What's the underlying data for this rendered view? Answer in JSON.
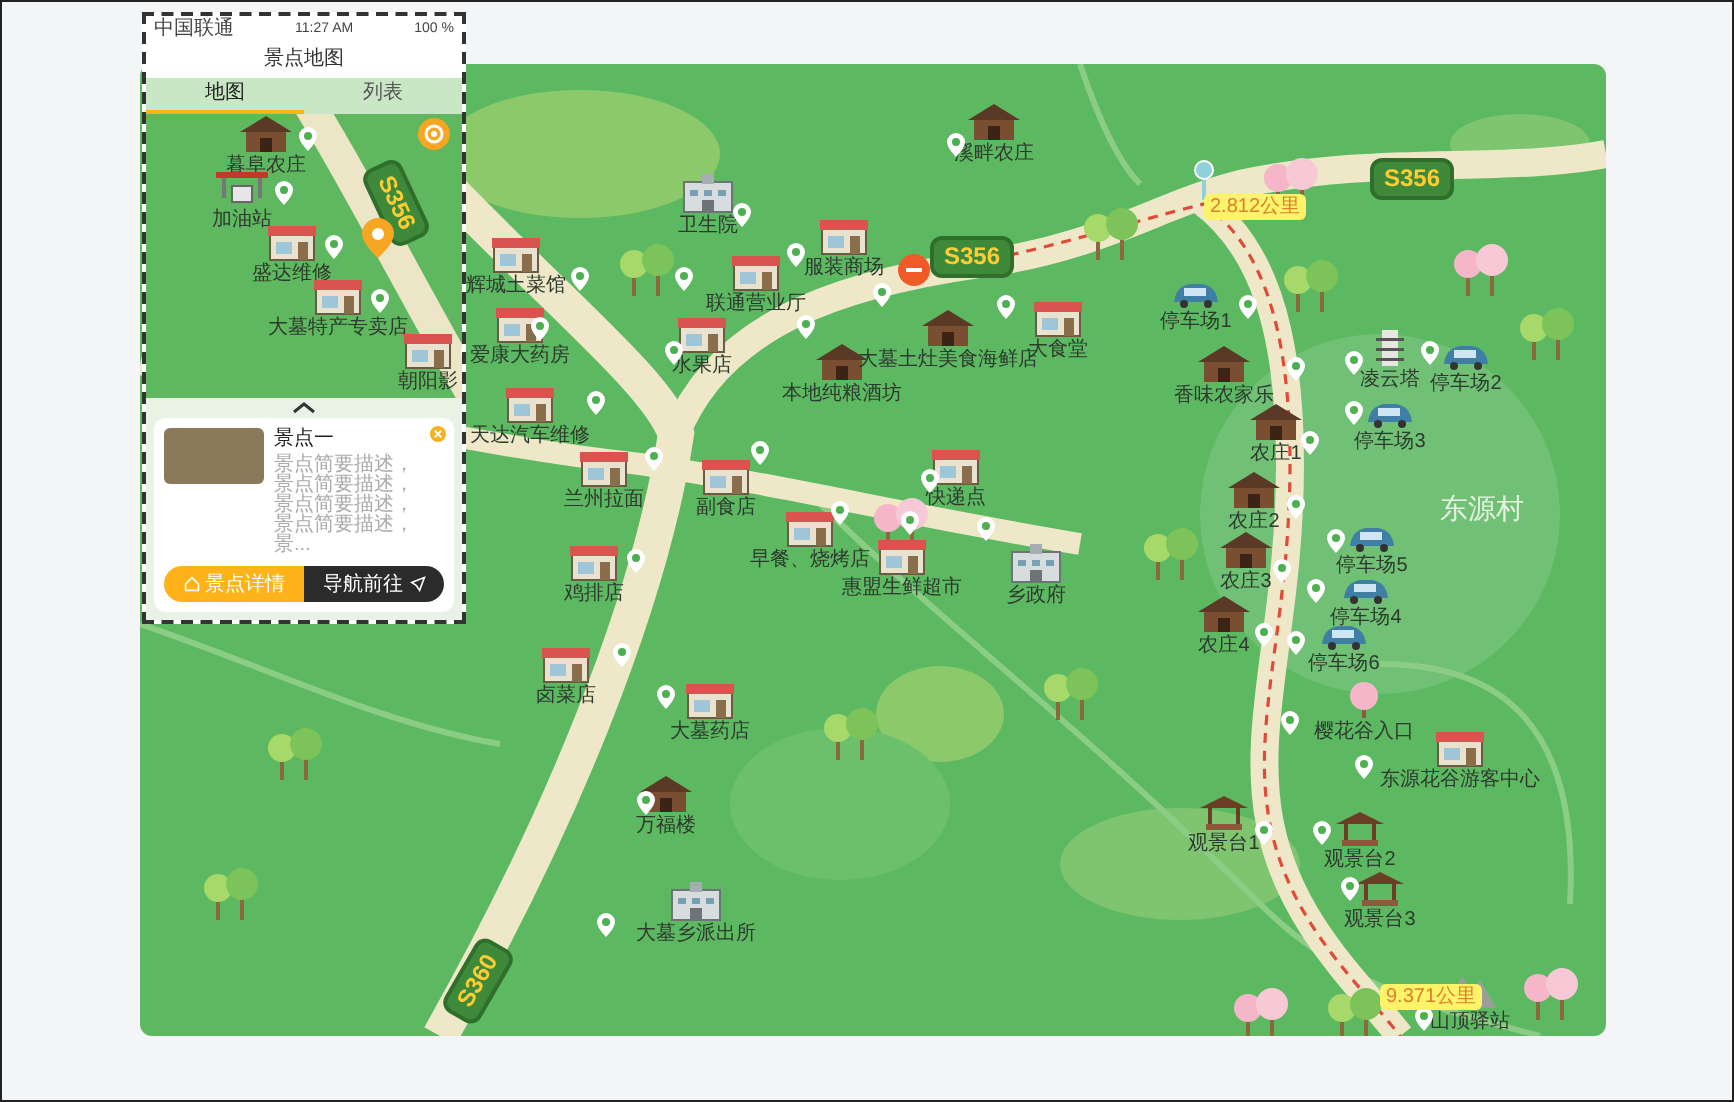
{
  "phone": {
    "status_bar": {
      "carrier": "中国联通",
      "time": "11:27 AM",
      "battery": "100 %"
    },
    "title": "景点地图",
    "tabs": [
      {
        "label": "地图",
        "selected": true
      },
      {
        "label": "列表",
        "selected": false
      }
    ],
    "places": [
      {
        "name": "暮阜农庄",
        "kind": "farm"
      },
      {
        "name": "加油站",
        "kind": "station"
      },
      {
        "name": "盛达维修",
        "kind": "shop"
      },
      {
        "name": "大墓特产专卖店",
        "kind": "shop"
      },
      {
        "name": "朝阳影",
        "kind": "shop"
      }
    ],
    "road_sign": "S356",
    "card": {
      "title": "景点一",
      "description": "景点简要描述，景点简要描述，景点简要描述，景点简要描述，景...",
      "buttons": [
        {
          "label": "景点详情",
          "kind": "primary"
        },
        {
          "label": "导航前往",
          "kind": "dark"
        }
      ]
    }
  },
  "map": {
    "village": "东源村",
    "road_signs": [
      "S356",
      "S356",
      "S360"
    ],
    "distances": [
      "2.812公里",
      "9.371公里"
    ],
    "places": [
      {
        "name": "溪畔农庄",
        "kind": "farm"
      },
      {
        "name": "卫生院",
        "kind": "office"
      },
      {
        "name": "服装商场",
        "kind": "shop"
      },
      {
        "name": "联通营业厅",
        "kind": "shop"
      },
      {
        "name": "辉城土菜馆",
        "kind": "shop"
      },
      {
        "name": "爱康大药房",
        "kind": "shop"
      },
      {
        "name": "水果店",
        "kind": "shop"
      },
      {
        "name": "本地纯粮酒坊",
        "kind": "farm"
      },
      {
        "name": "大墓土灶美食海鲜店",
        "kind": "farm"
      },
      {
        "name": "大食堂",
        "kind": "shop"
      },
      {
        "name": "天达汽车维修",
        "kind": "shop"
      },
      {
        "name": "兰州拉面",
        "kind": "shop"
      },
      {
        "name": "副食店",
        "kind": "shop"
      },
      {
        "name": "快递点",
        "kind": "shop"
      },
      {
        "name": "早餐、烧烤店",
        "kind": "shop"
      },
      {
        "name": "鸡排店",
        "kind": "shop"
      },
      {
        "name": "惠盟生鲜超市",
        "kind": "shop"
      },
      {
        "name": "乡政府",
        "kind": "office"
      },
      {
        "name": "卤菜店",
        "kind": "shop"
      },
      {
        "name": "大墓药店",
        "kind": "shop"
      },
      {
        "name": "万福楼",
        "kind": "farm"
      },
      {
        "name": "大墓乡派出所",
        "kind": "office"
      },
      {
        "name": "停车场1",
        "kind": "parking"
      },
      {
        "name": "香味农家乐",
        "kind": "farm"
      },
      {
        "name": "农庄1",
        "kind": "farm"
      },
      {
        "name": "农庄2",
        "kind": "farm"
      },
      {
        "name": "农庄3",
        "kind": "farm"
      },
      {
        "name": "农庄4",
        "kind": "farm"
      },
      {
        "name": "凌云塔",
        "kind": "tower"
      },
      {
        "name": "停车场2",
        "kind": "parking"
      },
      {
        "name": "停车场3",
        "kind": "parking"
      },
      {
        "name": "停车场5",
        "kind": "parking"
      },
      {
        "name": "停车场4",
        "kind": "parking"
      },
      {
        "name": "停车场6",
        "kind": "parking"
      },
      {
        "name": "樱花谷入口",
        "kind": "blossom"
      },
      {
        "name": "东源花谷游客中心",
        "kind": "shop"
      },
      {
        "name": "观景台1",
        "kind": "pavilion"
      },
      {
        "name": "观景台2",
        "kind": "pavilion"
      },
      {
        "name": "观景台3",
        "kind": "pavilion"
      },
      {
        "name": "山顶驿站",
        "kind": "mountain"
      }
    ]
  }
}
